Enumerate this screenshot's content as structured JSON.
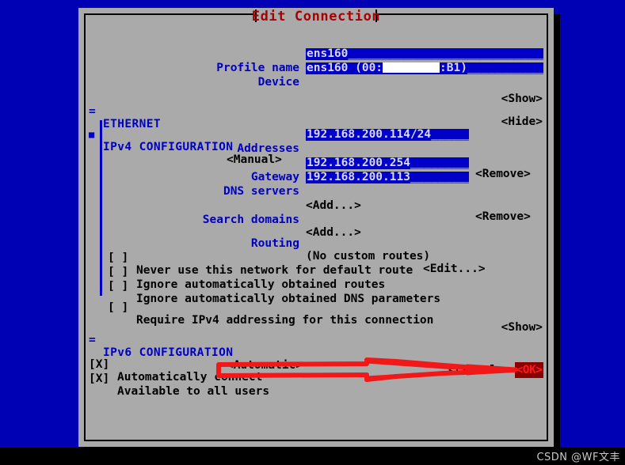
{
  "window": {
    "title": "Edit Connection"
  },
  "watermark": "CSDN @WF文丰",
  "form": {
    "profile_name": {
      "label": "Profile name",
      "value": "ens160",
      "padding": "______________________________________"
    },
    "device": {
      "label": "Device",
      "value_prefix": "ens160 (00:",
      "value_suffix": ":B1)",
      "padding": "______________"
    }
  },
  "sections": {
    "ethernet": {
      "marker": "=",
      "title": "ETHERNET",
      "toggle": "<Show>"
    },
    "ipv4": {
      "marker": "■",
      "title": "IPv4 CONFIGURATION",
      "method": "<Manual>",
      "toggle": "<Hide>",
      "addresses": {
        "label": "Addresses",
        "value": "192.168.200.114/24",
        "padding": "______",
        "remove": "<Remove>",
        "add": "<Add...>"
      },
      "gateway": {
        "label": "Gateway",
        "value": "192.168.200.254",
        "padding": "_________"
      },
      "dns_servers": {
        "label": "DNS servers",
        "value": "192.168.200.113",
        "padding": "_________",
        "remove": "<Remove>",
        "add": "<Add...>"
      },
      "search_domains": {
        "label": "Search domains",
        "add": "<Add...>"
      },
      "routing": {
        "label": "Routing",
        "value": "(No custom routes)",
        "edit": "<Edit...>"
      },
      "checkboxes": [
        {
          "box": "[ ]",
          "label": "Never use this network for default route"
        },
        {
          "box": "[ ]",
          "label": "Ignore automatically obtained routes"
        },
        {
          "box": "[ ]",
          "label": "Ignore automatically obtained DNS parameters"
        },
        {
          "box": "[ ]",
          "label": "Require IPv4 addressing for this connection"
        }
      ]
    },
    "ipv6": {
      "marker": "=",
      "title": "IPv6 CONFIGURATION",
      "method": "<Automatic>",
      "toggle": "<Show>"
    }
  },
  "global_checkboxes": [
    {
      "box": "[X]",
      "label": "Automatically connect"
    },
    {
      "box": "[X]",
      "label": "Available to all users"
    }
  ],
  "actions": {
    "cancel": "<Cancel>",
    "ok": "<OK>"
  },
  "colors": {
    "background": "#0000b4",
    "dialog": "#aaaaaa",
    "title": "#aa0000",
    "label": "#0000c0",
    "field_bg": "#0000c8",
    "field_fg": "#d8d8ff",
    "ok_bg": "#8b0000",
    "ok_fg": "#ff1a1a",
    "annotation": "#f01818"
  }
}
